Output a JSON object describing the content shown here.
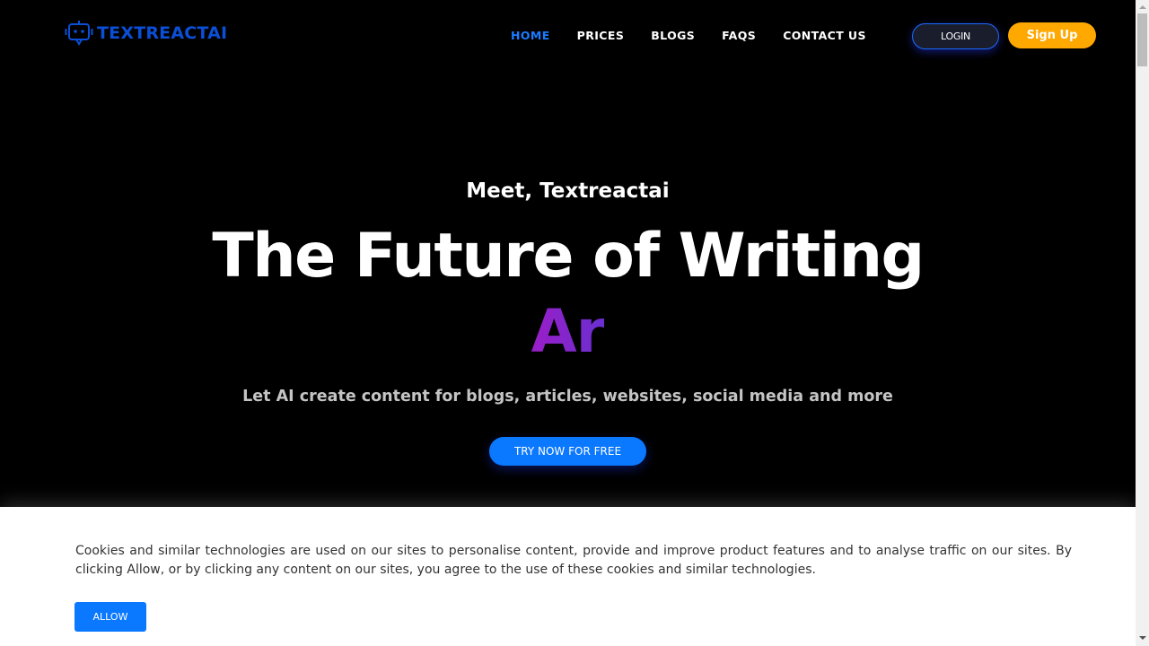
{
  "header": {
    "logo_text": "TEXTREACTAI",
    "nav": [
      {
        "label": "HOME",
        "active": true
      },
      {
        "label": "PRICES",
        "active": false
      },
      {
        "label": "BLOGS",
        "active": false
      },
      {
        "label": "FAQS",
        "active": false
      },
      {
        "label": "CONTACT US",
        "active": false
      }
    ],
    "login_label": "LOGIN",
    "signup_label": "Sign Up"
  },
  "hero": {
    "kicker": "Meet, Textreactai",
    "title": "The Future of Writing",
    "typed_text": "Ar",
    "subtitle": "Let AI create content for blogs, articles, websites, social media and more",
    "cta_label": "TRY NOW FOR FREE"
  },
  "cookie_banner": {
    "text": "Cookies and similar technologies are used on our sites to personalise content, provide and improve product features and to analyse traffic on our sites. By clicking Allow, or by clicking any content on our sites, you agree to the use of these cookies and similar technologies.",
    "allow_label": "ALLOW"
  },
  "colors": {
    "accent_blue": "#0a78ff",
    "logo_blue": "#0a4fd6",
    "signup_orange": "#ffa800",
    "nav_active": "#1a7cff",
    "typed_gradient_start": "#9a1ec8",
    "typed_gradient_end": "#6a2fd0"
  }
}
